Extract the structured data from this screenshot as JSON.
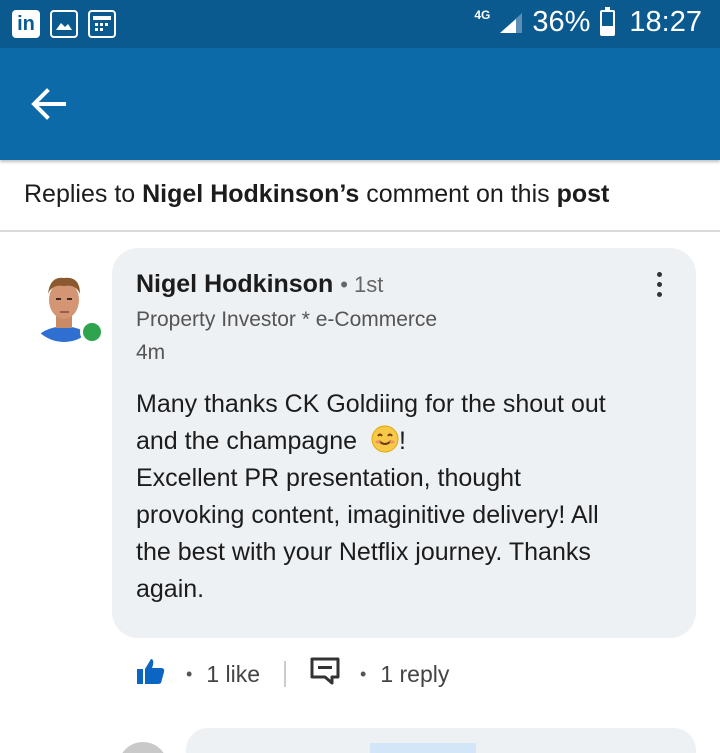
{
  "status_bar": {
    "icons": [
      "linkedin-icon",
      "gallery-icon",
      "calendar-icon"
    ],
    "network": "4G",
    "battery": "36%",
    "battery_level": 0.36,
    "time": "18:27"
  },
  "app_bar": {
    "back_icon": "arrow-left-icon"
  },
  "header": {
    "prefix": "Replies to ",
    "author": "Nigel Hodkinson’s",
    "middle": " comment on this ",
    "link": "post"
  },
  "comment": {
    "author": "Nigel Hodkinson",
    "degree": "1st",
    "headline": "Property Investor * e-Commerce",
    "time": "4m",
    "lines": [
      "Many thanks CK Goldiing for the shout out",
      "and the champagne",
      "Excellent PR presentation, thought",
      "provoking content, imaginitive delivery!  All",
      "the best with your Netflix journey. Thanks",
      "again."
    ],
    "emoji_suffix": "!"
  },
  "actions": {
    "likes": "1 like",
    "replies": "1 reply"
  },
  "colors": {
    "status_bar": "#0a5a8f",
    "app_bar": "#0d6aa8",
    "like_blue": "#0a66c2",
    "presence": "#2ea44f",
    "bubble": "#eef1f4"
  }
}
